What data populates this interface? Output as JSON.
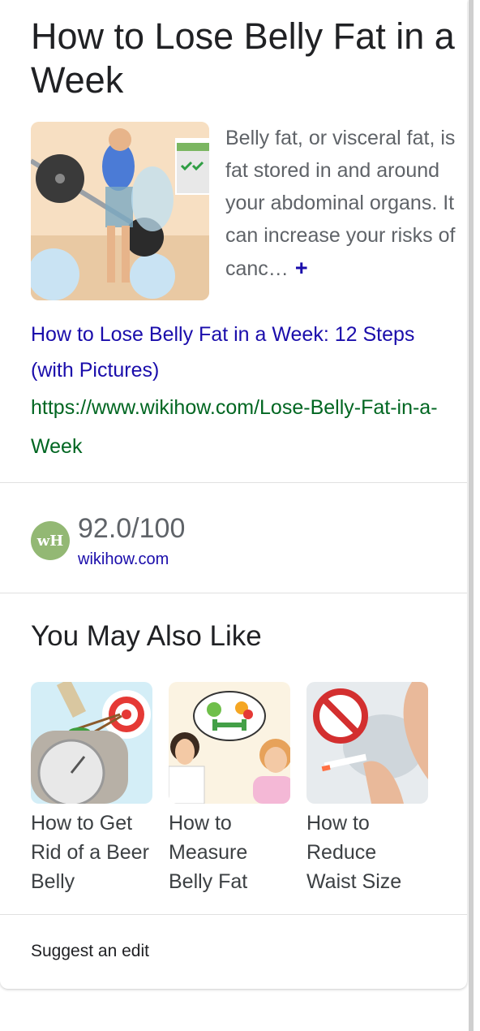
{
  "article": {
    "title": "How to Lose Belly Fat in a Week",
    "snippet": "Belly fat, or visceral fat, is fat stored in and around your abdominal organs. It can increase your risks of canc…",
    "expand_icon": "plus-icon",
    "expand_symbol": "+",
    "link_title": "How to Lose Belly Fat in a Week: 12 Steps (with Pictures)",
    "url": "https://www.wikihow.com/Lose-Belly-Fat-in-a-Week"
  },
  "rating": {
    "logo_text": "wH",
    "score": "92.0/100",
    "site": "wikihow.com"
  },
  "also_like": {
    "heading": "You May Also Like",
    "items": [
      {
        "label": "How to Get Rid of a Beer Belly"
      },
      {
        "label": "How to Measure Belly Fat"
      },
      {
        "label": "How to Reduce Waist Size"
      }
    ]
  },
  "footer": {
    "suggest_label": "Suggest an edit"
  },
  "colors": {
    "link": "#1a0dab",
    "url": "#006621",
    "logo_bg": "#93b874"
  }
}
